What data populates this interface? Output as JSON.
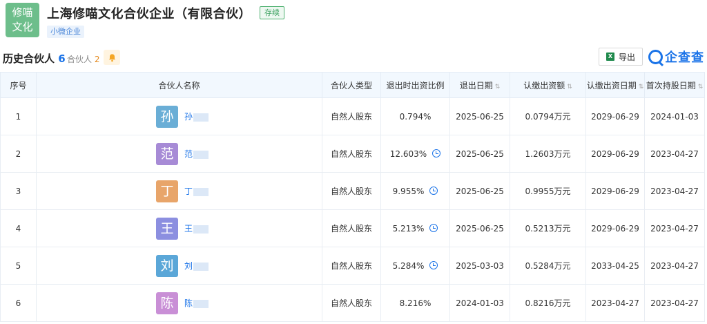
{
  "company": {
    "logo_lines": [
      "修喵",
      "文化"
    ],
    "name": "上海修喵文化合伙企业（有限合伙）",
    "status": "存续",
    "scale_tag": "小微企业",
    "logo_color": "#6dbe8b"
  },
  "section": {
    "title": "历史合伙人",
    "title_count": "6",
    "sub_tab": "合伙人",
    "sub_tab_count": "2"
  },
  "toolbar": {
    "export_label": "导出",
    "excel_icon": "X",
    "brand_text": "企查查"
  },
  "table": {
    "headers": [
      "序号",
      "合伙人名称",
      "合伙人类型",
      "退出时出资比例",
      "退出日期",
      "认缴出资额",
      "认缴出资日期",
      "首次持股日期"
    ],
    "rows": [
      {
        "index": "1",
        "avatar": "孙",
        "avatar_color": "#6aaed6",
        "name": "孙",
        "type": "自然人股东",
        "ratio": "0.794%",
        "exit_date": "2025-06-25",
        "amount": "0.0794万元",
        "subscribe_date": "2029-06-29",
        "first_date": "2024-01-03",
        "has_info": false
      },
      {
        "index": "2",
        "avatar": "范",
        "avatar_color": "#a78bd6",
        "name": "范",
        "type": "自然人股东",
        "ratio": "12.603%",
        "exit_date": "2025-06-25",
        "amount": "1.2603万元",
        "subscribe_date": "2029-06-29",
        "first_date": "2023-04-27",
        "has_info": true
      },
      {
        "index": "3",
        "avatar": "丁",
        "avatar_color": "#e8a56a",
        "name": "丁",
        "type": "自然人股东",
        "ratio": "9.955%",
        "exit_date": "2025-06-25",
        "amount": "0.9955万元",
        "subscribe_date": "2029-06-29",
        "first_date": "2023-04-27",
        "has_info": true
      },
      {
        "index": "4",
        "avatar": "王",
        "avatar_color": "#8c8fe0",
        "name": "王",
        "type": "自然人股东",
        "ratio": "5.213%",
        "exit_date": "2025-06-25",
        "amount": "0.5213万元",
        "subscribe_date": "2029-06-29",
        "first_date": "2023-04-27",
        "has_info": true
      },
      {
        "index": "5",
        "avatar": "刘",
        "avatar_color": "#5ba7d8",
        "name": "刘",
        "type": "自然人股东",
        "ratio": "5.284%",
        "exit_date": "2025-03-03",
        "amount": "0.5284万元",
        "subscribe_date": "2033-04-25",
        "first_date": "2023-04-27",
        "has_info": true
      },
      {
        "index": "6",
        "avatar": "陈",
        "avatar_color": "#c98fd6",
        "name": "陈",
        "type": "自然人股东",
        "ratio": "8.216%",
        "exit_date": "2024-01-03",
        "amount": "0.8216万元",
        "subscribe_date": "2023-04-27",
        "first_date": "2023-04-27",
        "has_info": false
      }
    ]
  },
  "colors": {
    "accent": "#1a73e8",
    "status_green": "#3aa05e",
    "header_bg": "#f2f8fe"
  }
}
